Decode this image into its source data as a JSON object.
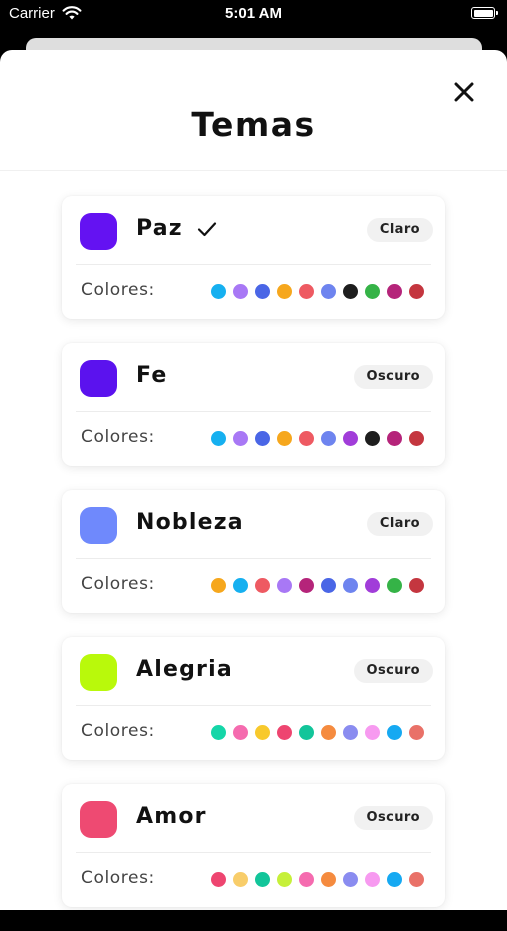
{
  "status_bar": {
    "carrier": "Carrier",
    "time": "5:01 AM"
  },
  "modal": {
    "title": "Temas",
    "close_icon": "close-icon",
    "colors_label": "Colores:"
  },
  "themes": [
    {
      "name": "Paz",
      "selected": true,
      "mode": "Claro",
      "swatch": "#6412F2",
      "colors": [
        "#16B0F0",
        "#A878F5",
        "#4A66E6",
        "#F6A71D",
        "#EE5A62",
        "#6E84EF",
        "#1E1E1E",
        "#35B347",
        "#B5247A",
        "#C4363F"
      ]
    },
    {
      "name": "Fe",
      "selected": false,
      "mode": "Oscuro",
      "swatch": "#5B12EE",
      "colors": [
        "#16B0F0",
        "#A878F5",
        "#4A66E6",
        "#F6A71D",
        "#EE5A62",
        "#6E84EF",
        "#A13DD9",
        "#1E1E1E",
        "#B5247A",
        "#C4363F"
      ]
    },
    {
      "name": "Nobleza",
      "selected": false,
      "mode": "Claro",
      "swatch": "#6F89FC",
      "colors": [
        "#F6A71D",
        "#16B0F0",
        "#EE5A62",
        "#A878F5",
        "#B5247A",
        "#4A66E6",
        "#6E84EF",
        "#A13DD9",
        "#35B347",
        "#C4363F"
      ]
    },
    {
      "name": "Alegria",
      "selected": false,
      "mode": "Oscuro",
      "swatch": "#B9F90B",
      "colors": [
        "#15D6A8",
        "#F56BAF",
        "#F8C92C",
        "#EE4570",
        "#12C59A",
        "#F58B3F",
        "#8A8CF0",
        "#F79AF0",
        "#16A9F2",
        "#E97168"
      ]
    },
    {
      "name": "Amor",
      "selected": false,
      "mode": "Oscuro",
      "swatch": "#EE4A72",
      "colors": [
        "#EE4570",
        "#F8CD6A",
        "#12C59A",
        "#C6F03A",
        "#F56BAF",
        "#F58B3F",
        "#8A8CF0",
        "#F79AF0",
        "#16A9F2",
        "#E97168"
      ]
    }
  ]
}
